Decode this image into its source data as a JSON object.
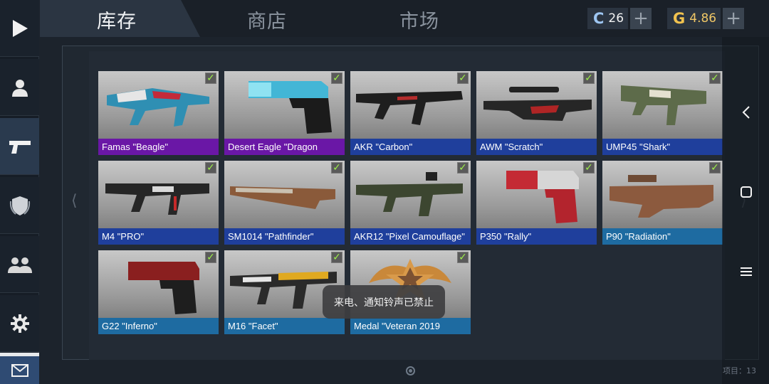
{
  "tabs": [
    {
      "label": "库存",
      "active": true
    },
    {
      "label": "商店",
      "active": false
    },
    {
      "label": "市场",
      "active": false
    }
  ],
  "currency": {
    "credits": {
      "icon": "C",
      "value": "26",
      "plus": "+"
    },
    "gold": {
      "icon": "G",
      "value": "4.86",
      "plus": "+"
    }
  },
  "sidebar": [
    {
      "icon": "play-icon"
    },
    {
      "icon": "profile-icon"
    },
    {
      "icon": "pistol-icon",
      "active": true
    },
    {
      "icon": "shield-icon"
    },
    {
      "icon": "friends-icon"
    },
    {
      "icon": "gear-icon"
    },
    {
      "icon": "mail-icon"
    }
  ],
  "items": [
    {
      "name": "Famas \"Beagle\"",
      "rarity": "purple",
      "equipped": true
    },
    {
      "name": "Desert Eagle \"Dragon",
      "rarity": "purple",
      "equipped": true
    },
    {
      "name": "AKR \"Carbon\"",
      "rarity": "blue",
      "equipped": true
    },
    {
      "name": "AWM \"Scratch\"",
      "rarity": "blue",
      "equipped": true
    },
    {
      "name": "UMP45 \"Shark\"",
      "rarity": "blue",
      "equipped": true
    },
    {
      "name": "M4 \"PRO\"",
      "rarity": "blue",
      "equipped": true
    },
    {
      "name": "SM1014 \"Pathfinder\"",
      "rarity": "blue",
      "equipped": true
    },
    {
      "name": "AKR12 \"Pixel Camouflage\"",
      "rarity": "blue",
      "equipped": true
    },
    {
      "name": "P350 \"Rally\"",
      "rarity": "blue",
      "equipped": true
    },
    {
      "name": "P90 \"Radiation\"",
      "rarity": "lightblue",
      "equipped": true
    },
    {
      "name": "G22 \"Inferno\"",
      "rarity": "lightblue",
      "equipped": true
    },
    {
      "name": "M16 \"Facet\"",
      "rarity": "lightblue",
      "equipped": true
    },
    {
      "name": "Medal \"Veteran 2019",
      "rarity": "lightblue",
      "equipped": true
    }
  ],
  "toast": "来电、通知铃声已禁止",
  "items_count": "项目：13",
  "colors": {
    "purple": "#6a17a6",
    "blue": "#1f3f9c",
    "lightblue": "#1e6ba1",
    "check": "#9df04a"
  }
}
